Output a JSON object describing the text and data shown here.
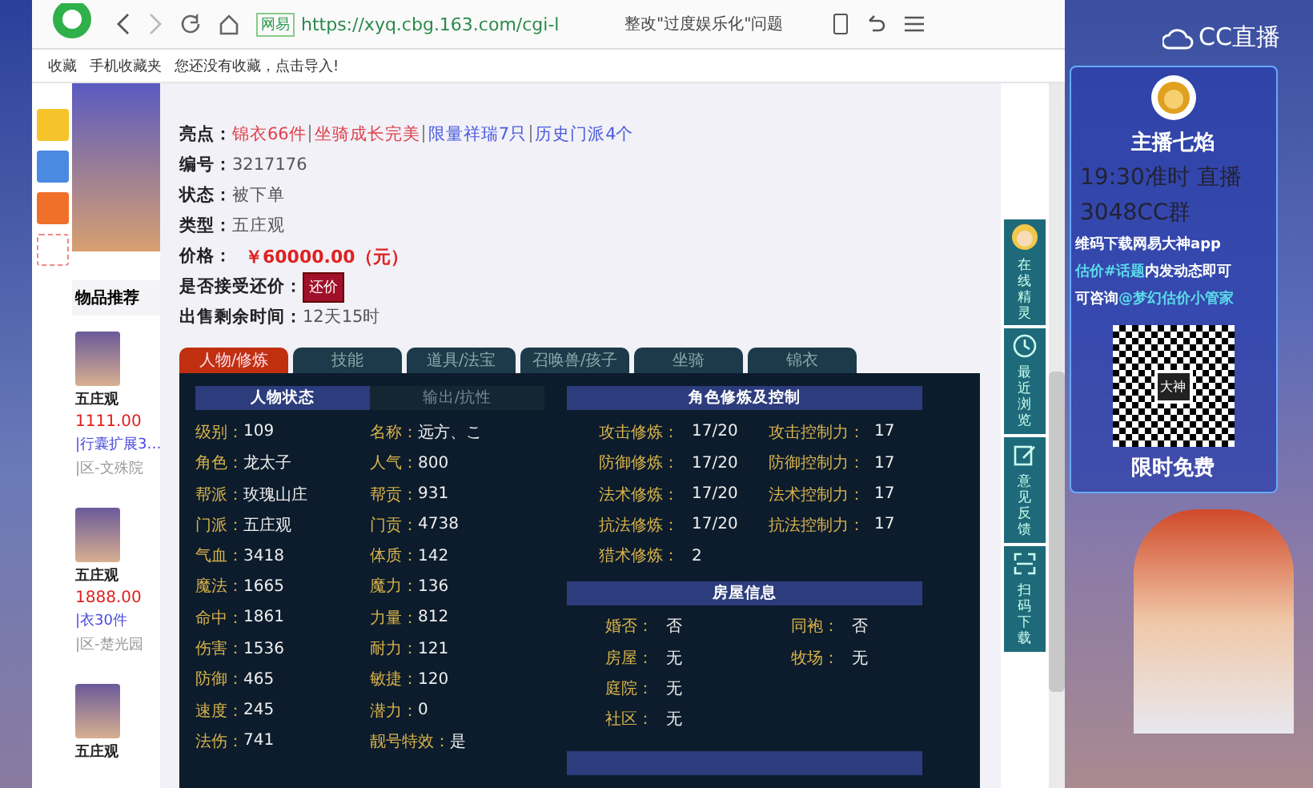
{
  "browser": {
    "url": "https://xyq.cbg.163.com/cgi-l",
    "site_badge": "网易",
    "search_text": "整改\"过度娱乐化\"问题",
    "bookmarks": [
      "收藏",
      "手机收藏夹",
      "您还没有收藏，点击导入!"
    ]
  },
  "recommend": {
    "title": "物品推荐",
    "items": [
      {
        "name": "五庄观",
        "price": "1111.00",
        "desc": "|行囊扩展3…",
        "server": "|区-文殊院"
      },
      {
        "name": "五庄观",
        "price": "1888.00",
        "desc": "|衣30件",
        "server": "|区-楚光园"
      },
      {
        "name": "五庄观"
      }
    ]
  },
  "listing": {
    "highlights_label": "亮点：",
    "highlights": [
      {
        "text": "锦衣66件",
        "color": "#e0404a"
      },
      {
        "text": "坐骑成长完美",
        "color": "#e0404a"
      },
      {
        "text": "限量祥瑞7只",
        "color": "#4a5ae0"
      },
      {
        "text": "历史门派4个",
        "color": "#4a5ae0"
      }
    ],
    "fields": [
      {
        "kind": "text",
        "label": "编号：",
        "value": "3217176"
      },
      {
        "kind": "text",
        "label": "状态：",
        "value": "被下单"
      },
      {
        "kind": "text",
        "label": "类型：",
        "value": "五庄观"
      },
      {
        "kind": "price",
        "label": "价格：",
        "value": "￥60000.00（元）"
      },
      {
        "kind": "button",
        "label": "是否接受还价：",
        "value": "还价"
      },
      {
        "kind": "text",
        "label": "出售剩余时间：",
        "value": "12天15时"
      }
    ]
  },
  "tabs": [
    {
      "label": "人物/修炼",
      "selected": true
    },
    {
      "label": "技能",
      "selected": false
    },
    {
      "label": "道具/法宝",
      "selected": false
    },
    {
      "label": "召唤兽/孩子",
      "selected": false
    },
    {
      "label": "坐骑",
      "selected": false
    },
    {
      "label": "锦衣",
      "selected": false
    }
  ],
  "panel": {
    "subtabs": [
      {
        "label": "人物状态",
        "selected": true
      },
      {
        "label": "输出/抗性",
        "selected": false
      }
    ],
    "stats": [
      {
        "label": "级别：",
        "value": "109",
        "label2": "名称：",
        "value2": "远方、こ"
      },
      {
        "label": "角色：",
        "value": "龙太子",
        "label2": "人气：",
        "value2": "800"
      },
      {
        "label": "帮派：",
        "value": "玫瑰山庄",
        "label2": "帮贡：",
        "value2": "931"
      },
      {
        "label": "门派：",
        "value": "五庄观",
        "label2": "门贡：",
        "value2": "4738"
      },
      {
        "label": "气血：",
        "value": "3418",
        "label2": "体质：",
        "value2": "142"
      },
      {
        "label": "魔法：",
        "value": "1665",
        "label2": "魔力：",
        "value2": "136"
      },
      {
        "label": "命中：",
        "value": "1861",
        "label2": "力量：",
        "value2": "812"
      },
      {
        "label": "伤害：",
        "value": "1536",
        "label2": "耐力：",
        "value2": "121"
      },
      {
        "label": "防御：",
        "value": "465",
        "label2": "敏捷：",
        "value2": "120"
      },
      {
        "label": "速度：",
        "value": "245",
        "label2": "潜力：",
        "value2": "0"
      },
      {
        "label": "法伤：",
        "value": "741",
        "label2": "靓号特效：",
        "value2": "是"
      }
    ],
    "training": {
      "title": "角色修炼及控制",
      "rows": [
        {
          "label": "攻击修炼：",
          "value": "17/20",
          "label2": "攻击控制力：",
          "value2": "17"
        },
        {
          "label": "防御修炼：",
          "value": "17/20",
          "label2": "防御控制力：",
          "value2": "17"
        },
        {
          "label": "法术修炼：",
          "value": "17/20",
          "label2": "法术控制力：",
          "value2": "17"
        },
        {
          "label": "抗法修炼：",
          "value": "17/20",
          "label2": "抗法控制力：",
          "value2": "17"
        },
        {
          "label": "猎术修炼：",
          "value": "2"
        }
      ]
    },
    "housing": {
      "title": "房屋信息",
      "rows": [
        {
          "label": "婚否：",
          "value": "否",
          "label2": "同袍：",
          "value2": "否"
        },
        {
          "label": "房屋：",
          "value": "无",
          "label2": "牧场：",
          "value2": "无"
        },
        {
          "label": "庭院：",
          "value": "无"
        },
        {
          "label": "社区：",
          "value": "无"
        }
      ]
    }
  },
  "tool_rail": [
    {
      "kind": "avatar",
      "label": "在线精灵"
    },
    {
      "kind": "clock",
      "label": "最近浏览"
    },
    {
      "kind": "edit",
      "label": "意见反馈"
    },
    {
      "kind": "scan",
      "label": "扫码下载"
    }
  ],
  "stream": {
    "logo": "CC直播",
    "host": "主播七焰",
    "overlay_lines": [
      "19:30准时 直播",
      "3048CC群"
    ],
    "promo_lines": [
      {
        "parts": [
          {
            "text": "维码下载网易大神app",
            "accent": false
          }
        ]
      },
      {
        "parts": [
          {
            "text": "估价#话题",
            "accent": true
          },
          {
            "text": "内发动态即可",
            "accent": false
          }
        ]
      },
      {
        "parts": [
          {
            "text": "可咨询",
            "accent": false
          },
          {
            "text": "@梦幻估价小管家",
            "accent": true
          }
        ]
      }
    ],
    "qr_label": "大神",
    "banner": "限时免费"
  }
}
